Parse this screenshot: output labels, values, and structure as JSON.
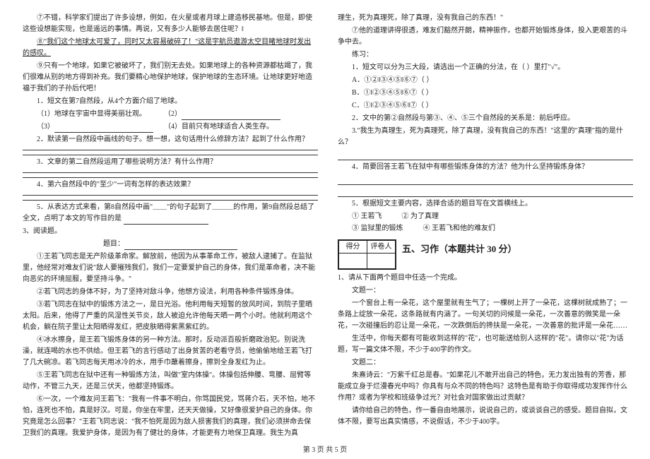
{
  "left": {
    "p7": "⑦不错，科学家们提出了许多设想，例如，在火星或者月球上建造移民基地。但是，即使这些设想能实现，也是遥远的事情。再说，又有多少人能够去居住呢？‖",
    "p8a": "⑧\"我们这个地球太可爱了，同时又太容易破碎了！\"这是宇航员遨游太空目睹地球时发出的感叹。",
    "p9": "⑨只有一个地球，如果它被破坏了，我们别无去处。如果地球上的各种资源都枯竭了，我们很难从别的地方得到补充。我们要精心地保护地球，保护地球的生态环境。让地球更好地造福于我们的子孙后代吧！",
    "q1_lead": "1．短文在第7自然段，从4个方面介绍了地球。",
    "q1_o1": "（1）地球在宇宙中显得美丽壮观。",
    "q1_o2": "（2）",
    "q1_o3": "（3）",
    "q1_o4": "（4）目前只有地球适合人类生存。",
    "q2": "2．默读第一自然段中画线的句子。想一想，这句话用什么修辞方法？起到了什么作用？",
    "q3": "3．文章的第二自然段运用了哪些说明方法？有什么作用？",
    "q4": "4．第六自然段中的\"至少\"一词有怎样的表达效果？",
    "q5": "5．从表达方式来看，第8自然段中画\"＿＿\"的句子起到了＿＿＿的作用，第9自然段总结了全文，点明了本文的写作目的是",
    "read_head": "3、阅读题。",
    "title_label": "题目：",
    "s1": "①王若飞同志是无产阶级革命家。解放前，他因为从事革命工作，被敌人逮捕了。在监狱里，他经常对难友们说\"敌人要摧残我们，我们一定要爱护自己的身体，我们是革命者，决不能向恶劣的环境屈服，要坚持斗争。\"",
    "s2": "②若飞同志的身体不好，为了坚持对敌斗争，他想方设法，利用各种条件锻炼身体。",
    "s3": "③若飞同志在狱中的锻炼方法之一，是日光浴。他利用每天短暂的放风时间，到院子里晒太阳。后来，他得了严重的风湿性关节炎，敌人被迫允许他每天晒一两个小时。他就利用这个机会，躺在院子里让太阳晒得发红，把皮肤晒得紫黑紫红的。",
    "s4": "④冰水擦身，是王若飞锻炼身体的另一种方法。那时，反动派百般折磨政治犯。别说洗澡，就连喝的水也不供给。但王若飞的言行感动了出身贫苦的老看守员，他偷偷地给王若飞打了几大碗凉。若飞同志每天用冰冷的水，用手巾蘸着擦身，擦到全身发红为止。",
    "s5": "⑤王若飞同志在狱中还有一种锻炼方法，叫做\"室内体操\"。体操包括伸腰、弯腰、屈臂等动作，不管三九天，还是三伏天，他都坚持锻炼。",
    "s6": "⑥一次，一个难友问王若飞：\"我有一件事不明白，你骂国民党，骂蒋介石，天不怕，地不怕，连死也不怕，真是好汉。可是，你坐在牢里，还天天做操，又好像很爱护自己的身体。你究竟是怎么回事？\"王若飞同志说：\"我不怕死是因为敌人损害我们的真理，我们必须拼命去保卫我们的真理。我爱护身体，是因为有了健壮的身体，才能更有力地保卫真理。我生为真"
  },
  "right": {
    "cont": "理生，死为真理死，除了真理，没有我自己的东西！\"",
    "s7": "⑦他的道理讲得很透，难友们豁然开朗，精神振作，也都开始锻炼身体，投入更艰苦的斗争中去。",
    "ex_head": "练习：",
    "ex1": "1．短文可以分为三大段，请选出一个正确的分法，在（  ）里打\"√\"。",
    "ex1a": "A．①②‖③④⑤‖⑥⑦（  ）",
    "ex1b": "B．①‖②③④⑤‖⑥⑦（  ）",
    "ex1c": "C．①‖②③④⑤⑥‖⑦（  ）",
    "ex2": "2．文中的第②自然段与第③、④、⑤三个自然段的关系是：前后呼应。",
    "ex3": "3.\"我生为真理生，死为真理死，除了真理，没有我自己的东西！\"这里的\"真理\"指的是什么？",
    "ex4": "4．简要回答王若飞在狱中有哪些锻炼身体的方法？他为什么坚持锻炼身体？",
    "ex5": "5．根据短文主要内容，选择合适的题目写在文首横线上。",
    "opt1": "① 王若飞",
    "opt2": "② 为了真理",
    "opt3": "③ 监狱里的锻炼",
    "opt4": "④ 王若飞和他的难友们",
    "score_l": "得分",
    "score_r": "评卷人",
    "sect5": "五、习作（本题共计 30 分）",
    "w1": "1、请从下面两个题目中任选一个完成。",
    "wt1": "文题一：",
    "wp1": "一个窗台上有一朵花，这个屋里就有生气了；一棵树上开了一朵花，这棵树就成熟了；一条路上绽放一朵花，这条路就有内涵了。一句关切的问候是一朵花，一次善意的微笑是一朵花，一次碰撞后的忍让是一朵花，一次跌倒后的搀扶是一朵花，一次善意的批评是一朵花……",
    "wp2": "生活中，你每天都有可能收到这样的\"花\"，也可能送给别人这样的\"花\"。请你以\"花\"为话题，写一篇文体不限，不少于400字的作文。",
    "wt2": "文题二：",
    "wp3": "朱熹诗云：\"万紫千红总是春。\"如果花儿不敢开出自己的特色，无力发出独有的芳香，那能成立身于烂漫春光中吗？你具有与众不同的特色吗？这特色是有助于你取得成功发挥作什么作用？或者为学校和班级争过光？对社会对国家做出过贡献？",
    "wp4": "请你给自己的特色，作一番自由地展示，说说自己的，或谈谈自己的感受。题目自拟，文体不限，要写出真实情感，不说假话，不少于400字。"
  },
  "footer": "第 3 页 共 5 页"
}
